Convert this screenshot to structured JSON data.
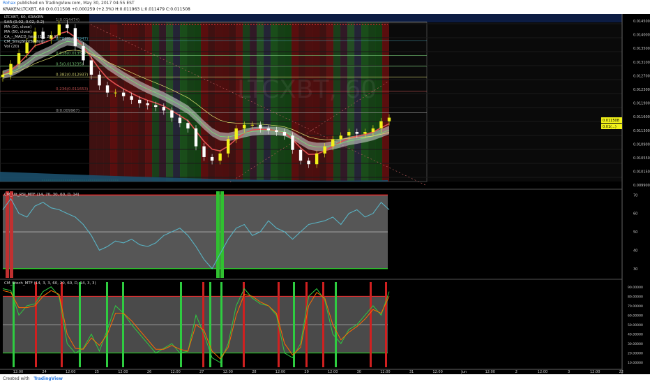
{
  "header": {
    "author": "Rohax",
    "published": "published on TradingView.com, May 30, 2017 04:55 EST",
    "symbol_line": "KRAKEN:LTCXBT, 60  O:0.011508  +0.000259 (+2.3%)  H:0.011963  L:0.011479  C:0.011508"
  },
  "legend": {
    "items": [
      "LTCXBT, 60, KRAKEN",
      "SAR (0.02, 0.02, 0.2)",
      "MA (10, close)",
      "MA (50, close)",
      "CA_-_MACD_heat (12, 26, 9)",
      "CM_SlingShotSystem",
      "Vol (20)"
    ]
  },
  "watermark": "LTCXBT, 60",
  "fib_levels": [
    {
      "label": "1(0.014474)",
      "value": 0.014474
    },
    {
      "label": "0.786(0.013947)",
      "value": 0.013947
    },
    {
      "label": "0.618(0.013534)",
      "value": 0.013534
    },
    {
      "label": "0.5(0.013235)",
      "value": 0.013235
    },
    {
      "label": "0.382(0.012937)",
      "value": 0.012937
    },
    {
      "label": "0.236(0.011653)",
      "value": 0.01254
    },
    {
      "label": "0(0.009967)",
      "value": 0.01194
    }
  ],
  "price_badges": {
    "close": "0.011508",
    "sar": "0.01(...)"
  },
  "rsi_label": "CM_Ult_RSI_MTF (14, 70, 30, 60, D, 14)",
  "stoch_label": "CM_Stoch_MTF (14, 3, 3, 60, 20, 60, D, 14, 3, 3)",
  "footer": {
    "created": "Created with",
    "brand": "TradingView"
  },
  "colors": {
    "up": "#f2f21a",
    "down": "#ffffff",
    "rsi": "#59b3c4",
    "stochK": "#2ecc40",
    "stochD": "#ff6a00",
    "ob": "#ff2a2a",
    "os": "#22dd22"
  },
  "chart_data": [
    {
      "type": "candlestick",
      "panel": "price",
      "ylim": [
        0.0099,
        0.0145
      ],
      "y_ticks": [
        "0.014500",
        "0.014000",
        "0.013500",
        "0.013100",
        "0.012700",
        "0.012300",
        "0.011900",
        "0.011600",
        "0.011300",
        "0.010900",
        "0.010550",
        "0.010150",
        "0.009900"
      ],
      "x_ticks": [
        "12:00",
        "24",
        "12:00",
        "25",
        "12:00",
        "26",
        "12:00",
        "27",
        "12:00",
        "28",
        "12:00",
        "29",
        "12:00",
        "30",
        "12:00",
        "31",
        "12:00",
        "Jun",
        "12:00",
        "2",
        "12:00",
        "3",
        "12:00",
        "22"
      ],
      "close": [
        0.013,
        0.0133,
        0.0136,
        0.0139,
        0.0142,
        0.014,
        0.0141,
        0.0144,
        0.0143,
        0.0138,
        0.0134,
        0.013,
        0.0127,
        0.0125,
        0.0125,
        0.0124,
        0.0123,
        0.0122,
        0.01215,
        0.0121,
        0.012,
        0.0118,
        0.01165,
        0.0115,
        0.011,
        0.0107,
        0.0106,
        0.0108,
        0.0112,
        0.0115,
        0.0116,
        0.0116,
        0.0115,
        0.01145,
        0.0114,
        0.0113,
        0.0109,
        0.0106,
        0.0105,
        0.0108,
        0.011,
        0.0112,
        0.0113,
        0.0114,
        0.01135,
        0.0114,
        0.0115,
        0.0117,
        0.0118
      ]
    },
    {
      "type": "line",
      "panel": "rsi",
      "ylim": [
        25,
        72
      ],
      "y_ticks": [
        "70",
        "60",
        "50",
        "40",
        "30"
      ],
      "levels": [
        70,
        50,
        30
      ],
      "values": [
        62,
        68,
        60,
        58,
        64,
        66,
        63,
        62,
        60,
        58,
        54,
        48,
        40,
        42,
        45,
        44,
        46,
        43,
        42,
        44,
        48,
        50,
        52,
        48,
        42,
        35,
        30,
        38,
        46,
        52,
        54,
        48,
        50,
        56,
        52,
        50,
        46,
        50,
        54,
        55,
        56,
        58,
        54,
        60,
        62,
        58,
        60,
        66,
        62
      ]
    },
    {
      "type": "line",
      "panel": "stoch",
      "ylim": [
        5,
        95
      ],
      "y_ticks": [
        "90.00000",
        "80.00000",
        "70.00000",
        "60.00000",
        "50.00000",
        "40.00000",
        "30.00000",
        "20.00000",
        "10.00000"
      ],
      "levels": [
        80,
        50,
        20
      ],
      "series": [
        {
          "name": "K",
          "values": [
            88,
            86,
            60,
            70,
            72,
            85,
            90,
            80,
            30,
            20,
            25,
            40,
            22,
            45,
            70,
            62,
            50,
            40,
            30,
            20,
            25,
            30,
            20,
            22,
            60,
            40,
            15,
            10,
            30,
            70,
            88,
            78,
            72,
            70,
            60,
            20,
            15,
            30,
            80,
            88,
            76,
            40,
            30,
            45,
            50,
            60,
            70,
            60,
            85
          ]
        },
        {
          "name": "D",
          "values": [
            86,
            84,
            68,
            68,
            70,
            80,
            86,
            82,
            40,
            25,
            24,
            36,
            28,
            40,
            62,
            62,
            54,
            44,
            34,
            24,
            24,
            28,
            24,
            22,
            50,
            44,
            22,
            14,
            26,
            60,
            82,
            80,
            74,
            70,
            62,
            30,
            18,
            26,
            70,
            84,
            78,
            50,
            34,
            42,
            48,
            56,
            66,
            62,
            80
          ]
        }
      ]
    }
  ]
}
